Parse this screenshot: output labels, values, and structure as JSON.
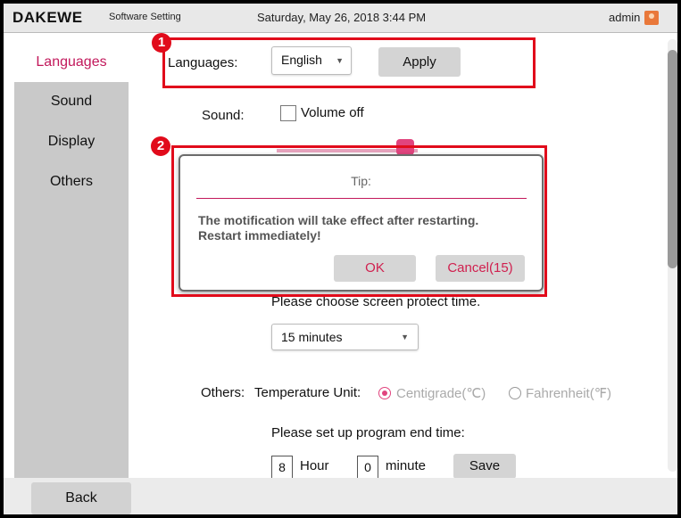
{
  "header": {
    "brand": "DAKEWE",
    "app_title": "Software Setting",
    "datetime": "Saturday, May 26, 2018 3:44 PM",
    "user": "admin"
  },
  "sidebar": {
    "items": [
      {
        "label": "Languages",
        "active": true
      },
      {
        "label": "Sound",
        "active": false
      },
      {
        "label": "Display",
        "active": false
      },
      {
        "label": "Others",
        "active": false
      }
    ]
  },
  "languages": {
    "label": "Languages:",
    "selected": "English",
    "apply_label": "Apply"
  },
  "sound": {
    "label": "Sound:",
    "volume_off_label": "Volume off",
    "volume_off_checked": false
  },
  "display": {
    "protect_prompt": "Please choose screen protect time.",
    "protect_selected": "15 minutes"
  },
  "others": {
    "label": "Others:",
    "temp_unit_label": "Temperature Unit:",
    "centigrade_label": "Centigrade(℃)",
    "fahrenheit_label": "Fahrenheit(℉)",
    "selected_unit": "Centigrade",
    "end_time_prompt": "Please set up program end time:",
    "hour_value": "8",
    "hour_label": "Hour",
    "minute_value": "0",
    "minute_label": "minute",
    "save_label": "Save"
  },
  "footer": {
    "back_label": "Back"
  },
  "dialog": {
    "title": "Tip:",
    "message_line1": "The motification will take effect after restarting.",
    "message_line2": "Restart immediately!",
    "ok_label": "OK",
    "cancel_label": "Cancel(15)"
  },
  "annotations": [
    {
      "number": "1"
    },
    {
      "number": "2"
    }
  ],
  "colors": {
    "accent": "#e1447e",
    "annotation_red": "#e10b1b",
    "sidebar_bg": "#c9c9c9"
  }
}
